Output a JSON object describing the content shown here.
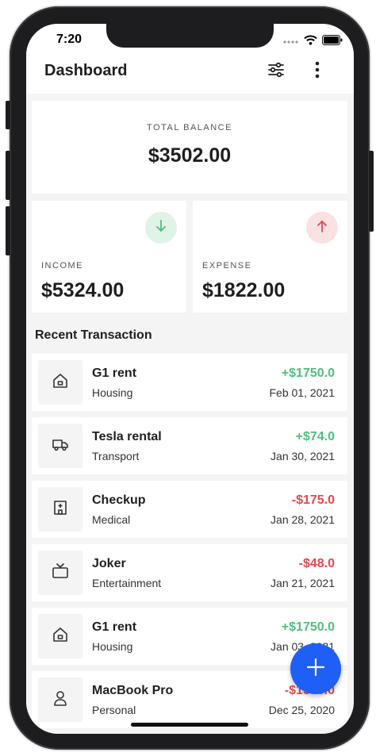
{
  "status_bar": {
    "time": "7:20"
  },
  "header": {
    "title": "Dashboard"
  },
  "balance": {
    "label": "TOTAL BALANCE",
    "value": "$3502.00"
  },
  "income": {
    "label": "INCOME",
    "value": "$5324.00"
  },
  "expense": {
    "label": "EXPENSE",
    "value": "$1822.00"
  },
  "recent": {
    "title": "Recent Transaction",
    "items": [
      {
        "title": "G1 rent",
        "category": "Housing",
        "amount": "+$1750.0",
        "date": "Feb 01, 2021",
        "icon": "house-icon",
        "type": "income"
      },
      {
        "title": "Tesla rental",
        "category": "Transport",
        "amount": "+$74.0",
        "date": "Jan 30, 2021",
        "icon": "truck-icon",
        "type": "income"
      },
      {
        "title": "Checkup",
        "category": "Medical",
        "amount": "-$175.0",
        "date": "Jan 28, 2021",
        "icon": "hospital-icon",
        "type": "expense"
      },
      {
        "title": "Joker",
        "category": "Entertainment",
        "amount": "-$48.0",
        "date": "Jan 21, 2021",
        "icon": "tv-icon",
        "type": "expense"
      },
      {
        "title": "G1 rent",
        "category": "Housing",
        "amount": "+$1750.0",
        "date": "Jan 03, 2021",
        "icon": "house-icon",
        "type": "income"
      },
      {
        "title": "MacBook Pro",
        "category": "Personal",
        "amount": "-$1500.0",
        "date": "Dec 25, 2020",
        "icon": "person-icon",
        "type": "expense"
      }
    ]
  },
  "colors": {
    "income": "#4fbf7f",
    "expense": "#e5484d",
    "accent": "#1f5ff5",
    "income_bg": "#dff3e6",
    "expense_bg": "#fbe1e1"
  }
}
